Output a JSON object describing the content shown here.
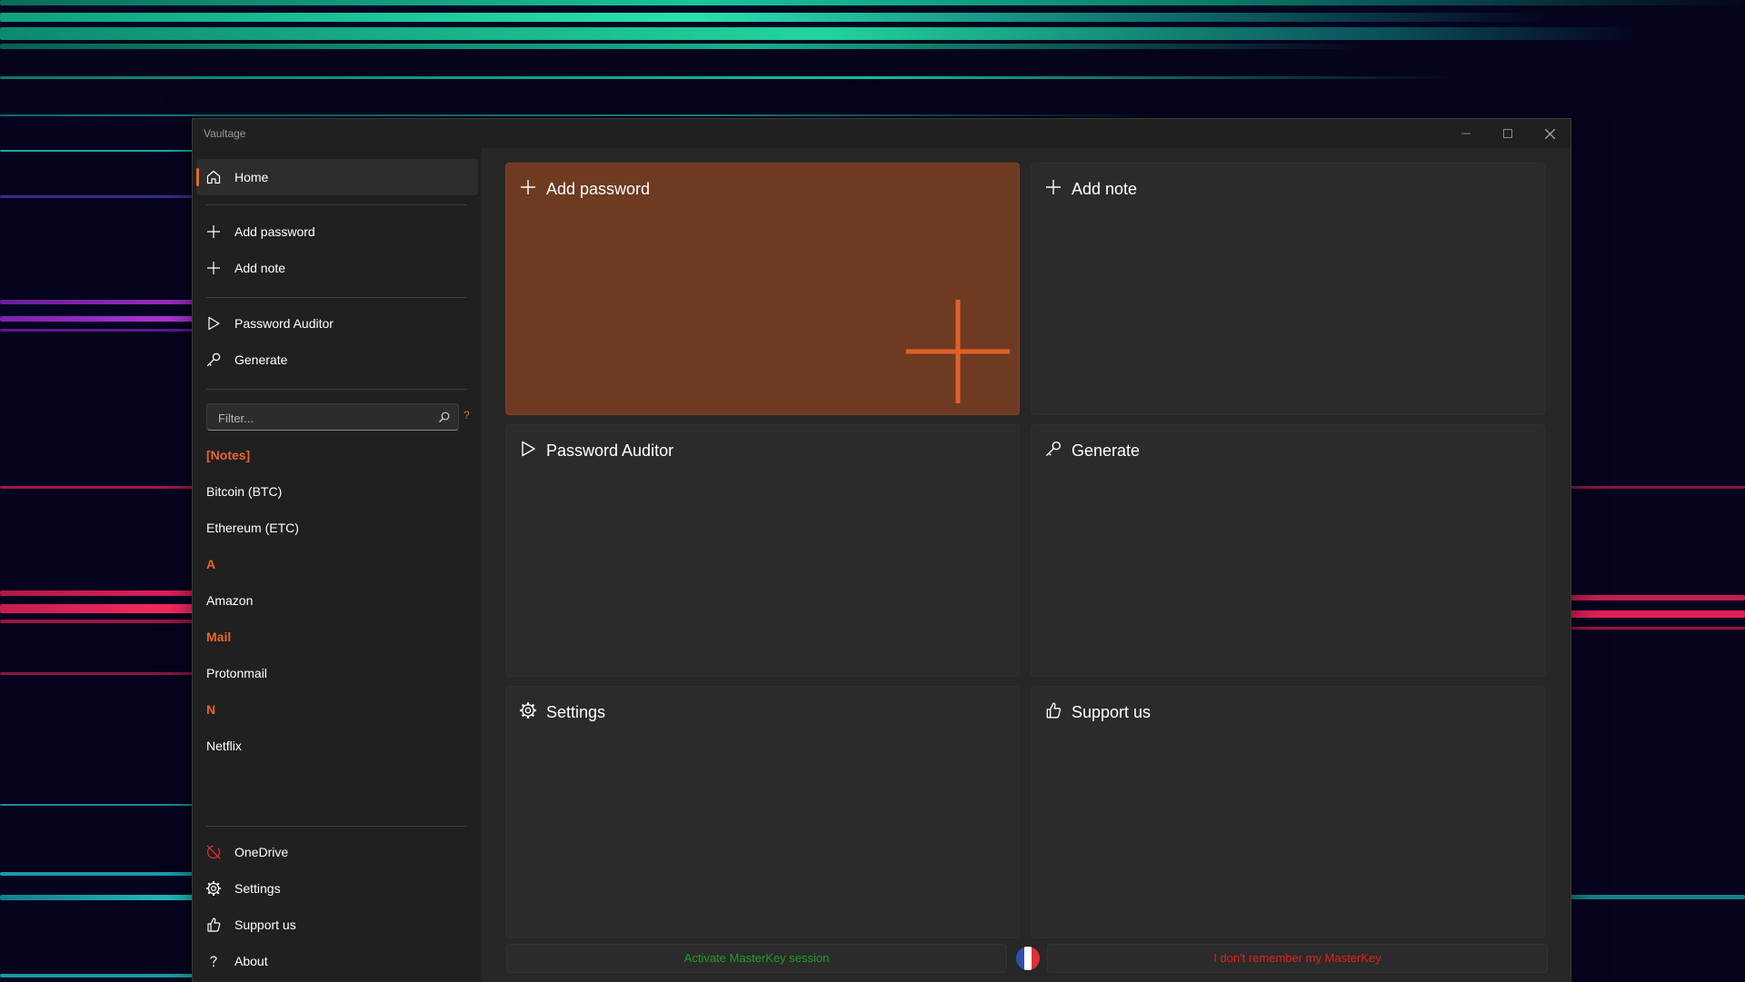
{
  "window": {
    "title": "Vaultage"
  },
  "sidebar": {
    "home_label": "Home",
    "add_password_label": "Add password",
    "add_note_label": "Add note",
    "password_auditor_label": "Password Auditor",
    "generate_label": "Generate",
    "filter_placeholder": "Filter...",
    "filter_help": "?",
    "groups": [
      {
        "header": "[Notes]",
        "items": [
          "Bitcoin (BTC)",
          "Ethereum (ETC)"
        ]
      },
      {
        "header": "A",
        "items": [
          "Amazon"
        ]
      },
      {
        "header": "Mail",
        "items": [
          "Protonmail"
        ]
      },
      {
        "header": "N",
        "items": [
          "Netflix"
        ]
      }
    ],
    "onedrive_label": "OneDrive",
    "settings_label": "Settings",
    "support_label": "Support us",
    "about_label": "About"
  },
  "cards": {
    "add_password": "Add password",
    "add_note": "Add note",
    "password_auditor": "Password Auditor",
    "generate": "Generate",
    "settings": "Settings",
    "support": "Support us"
  },
  "footer": {
    "activate_session": "Activate MasterKey session",
    "forgot_masterkey": "I don't remember my MasterKey"
  },
  "colors": {
    "accent": "#e8662c",
    "accent_card": "#6e3b22",
    "success_text": "#1f9d2b",
    "danger_text": "#e0201c",
    "onedrive_icon": "#d93030"
  },
  "icons": {
    "home": "home-icon",
    "add": "plus-icon",
    "auditor": "play-icon",
    "generate": "key-icon",
    "filter": "search-icon",
    "onedrive": "sync-disabled-icon",
    "settings": "gear-icon",
    "support": "thumbs-up-icon",
    "about": "question-icon",
    "language": "french-flag-icon"
  }
}
